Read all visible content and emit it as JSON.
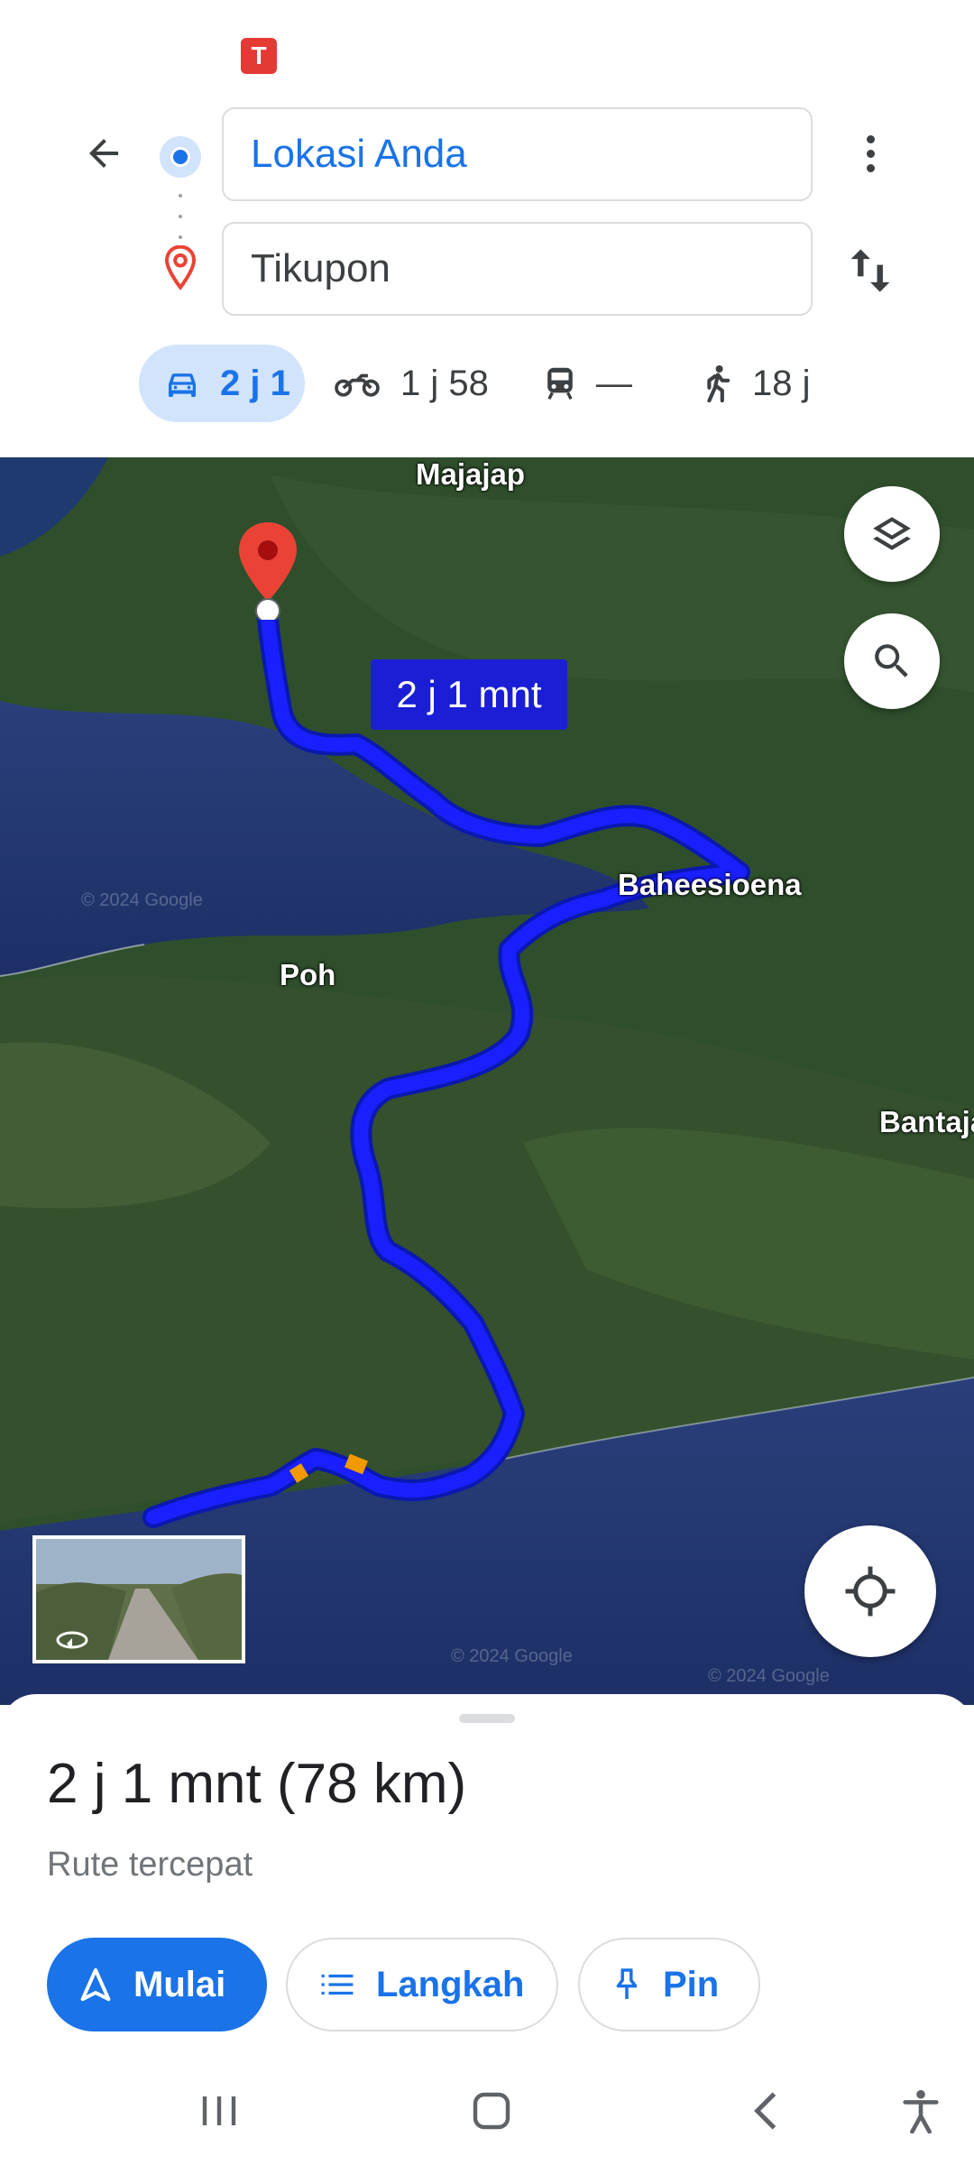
{
  "status_bar": {
    "notification_icon": "t-app-icon"
  },
  "directions": {
    "origin": "Lokasi Anda",
    "destination": "Tikupon"
  },
  "modes": [
    {
      "icon": "car-icon",
      "time": "2 j 1",
      "selected": true
    },
    {
      "icon": "motorcycle-icon",
      "time": "1 j 58",
      "selected": false
    },
    {
      "icon": "transit-icon",
      "time": "—",
      "selected": false
    },
    {
      "icon": "walk-icon",
      "time": "18 j",
      "selected": false
    }
  ],
  "map": {
    "labels": {
      "majajap": "Majajap",
      "baheesioena": "Baheesioena",
      "poh": "Poh",
      "bantaja": "Bantaja"
    },
    "route_duration": "2 j 1 mnt",
    "watermark": "© 2024 Google",
    "route_color": "#1a1fff",
    "traffic_color": "#f29900"
  },
  "sheet": {
    "duration": "2 j 1 mnt",
    "distance": "(78 km)",
    "route_type": "Rute tercepat",
    "buttons": {
      "start": "Mulai",
      "steps": "Langkah",
      "pin": "Pin"
    }
  },
  "colors": {
    "accent": "#1a73e8",
    "accent_light": "#d2e3fc",
    "destination_pin": "#ea4335"
  }
}
